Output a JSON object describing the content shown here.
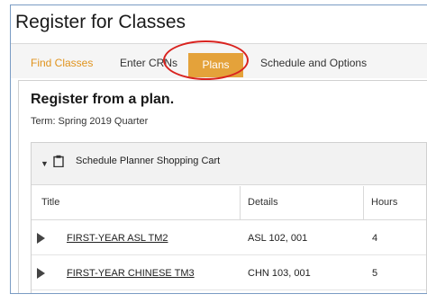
{
  "page": {
    "title": "Register for Classes"
  },
  "tabs": [
    {
      "label": "Find Classes",
      "active": false,
      "accent": "#e0931d"
    },
    {
      "label": "Enter CRNs",
      "active": false
    },
    {
      "label": "Plans",
      "active": true,
      "accent": "#e4a23a"
    },
    {
      "label": "Schedule and Options",
      "active": false
    }
  ],
  "highlight": {
    "color": "#d9231f",
    "target": "Plans"
  },
  "section": {
    "title": "Register from a plan.",
    "term": "Term: Spring 2019 Quarter"
  },
  "cart": {
    "title": "Schedule Planner Shopping Cart",
    "icon": "clipboard-icon",
    "columns": [
      "Title",
      "Details",
      "Hours"
    ],
    "rows": [
      {
        "title": "FIRST-YEAR ASL TM2",
        "details": "ASL 102, 001",
        "hours": "4"
      },
      {
        "title": "FIRST-YEAR CHINESE TM3",
        "details": "CHN 103, 001",
        "hours": "5"
      }
    ]
  }
}
